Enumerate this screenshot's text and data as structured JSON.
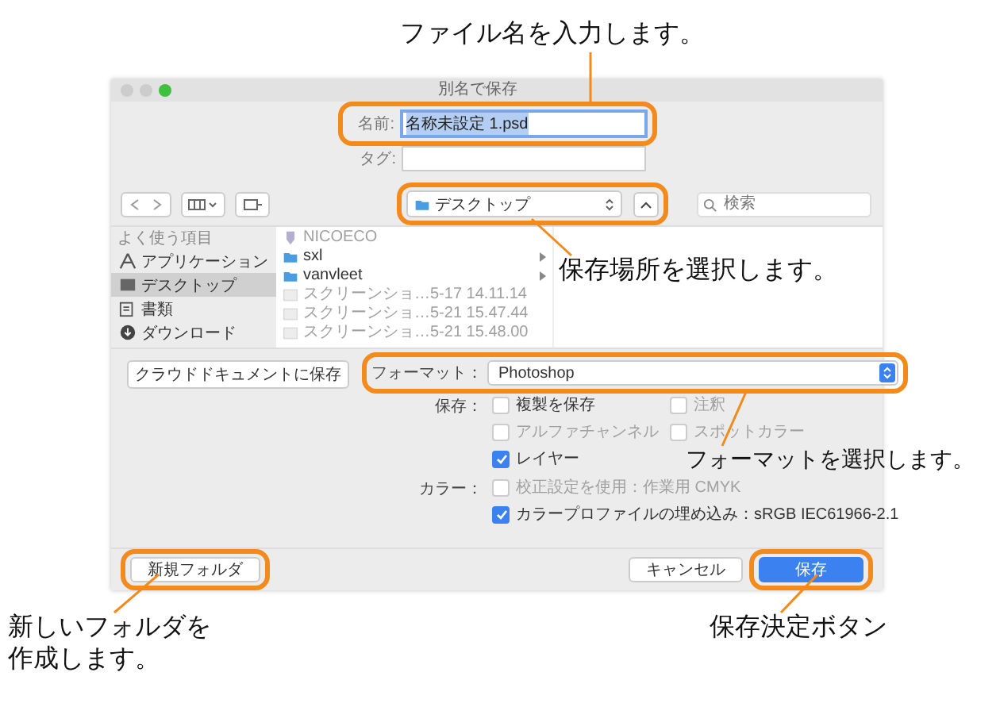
{
  "annotations": [
    {
      "text": "ファイル名を入力します。"
    },
    {
      "text": "保存場所を選択します。"
    },
    {
      "text": "フォーマットを選択します。"
    },
    {
      "text": "新しいフォルダを作成します。"
    },
    {
      "text": "保存決定ボタン"
    }
  ],
  "dialog": {
    "title": "別名で保存",
    "name_field": {
      "label": "名前:",
      "value": "名称未設定 1.psd"
    },
    "tag_field": {
      "label": "タグ:"
    },
    "location": {
      "value": "デスクトップ"
    },
    "search": {
      "placeholder": "検索"
    },
    "sidebar": {
      "heading": "よく使う項目",
      "items": [
        {
          "label": "アプリケーション",
          "selected": false
        },
        {
          "label": "デスクトップ",
          "selected": true
        },
        {
          "label": "書類",
          "selected": false
        },
        {
          "label": "ダウンロード",
          "selected": false
        }
      ]
    },
    "files": [
      {
        "name": "NICOECO",
        "kind": "drive",
        "disabled": true
      },
      {
        "name": "sxl",
        "kind": "folder",
        "disabled": false
      },
      {
        "name": "vanvleet",
        "kind": "folder",
        "disabled": false
      },
      {
        "name": "スクリーンショ…5-17 14.11.14",
        "kind": "image",
        "disabled": true
      },
      {
        "name": "スクリーンショ…5-21 15.47.44",
        "kind": "image",
        "disabled": true
      },
      {
        "name": "スクリーンショ…5-21 15.48.00",
        "kind": "image",
        "disabled": true
      }
    ],
    "cloud_button": "クラウドドキュメントに保存",
    "format": {
      "label": "フォーマット：",
      "value": "Photoshop"
    },
    "option_groups": [
      {
        "label": "保存：",
        "items": [
          {
            "label": "複製を保存",
            "checked": false,
            "disabled": false
          },
          {
            "label": "注釈",
            "checked": false,
            "disabled": true
          },
          {
            "label": "アルファチャンネル",
            "checked": false,
            "disabled": true
          },
          {
            "label": "スポットカラー",
            "checked": false,
            "disabled": true
          },
          {
            "label": "レイヤー",
            "checked": true,
            "disabled": false
          }
        ]
      },
      {
        "label": "カラー：",
        "items": [
          {
            "label": "校正設定を使用：作業用 CMYK",
            "checked": false,
            "disabled": true
          },
          {
            "label": "カラープロファイルの埋め込み：sRGB IEC61966-2.1",
            "checked": true,
            "disabled": false
          }
        ]
      }
    ],
    "buttons": [
      {
        "label": "新規フォルダ",
        "kind": "secondary"
      },
      {
        "label": "キャンセル",
        "kind": "secondary"
      },
      {
        "label": "保存",
        "kind": "primary"
      }
    ]
  }
}
